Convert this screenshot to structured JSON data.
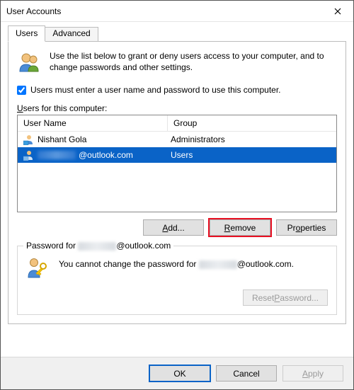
{
  "window": {
    "title": "User Accounts"
  },
  "tabs": {
    "users": "Users",
    "advanced": "Advanced"
  },
  "intro": "Use the list below to grant or deny users access to your computer, and to change passwords and other settings.",
  "checkbox_label": "Users must enter a user name and password to use this computer.",
  "list_label_prefix": "U",
  "list_label_rest": "sers for this computer:",
  "columns": {
    "name": "User Name",
    "group": "Group"
  },
  "rows": [
    {
      "name": "Nishant Gola",
      "group": "Administrators",
      "selected": false,
      "redacted": false
    },
    {
      "name": "@outlook.com",
      "group": "Users",
      "selected": true,
      "redacted": true
    }
  ],
  "buttons": {
    "add_pre": "A",
    "add_rest": "dd...",
    "remove_pre": "R",
    "remove_rest": "emove",
    "props_pre": "Pr",
    "props_u": "o",
    "props_rest": "perties"
  },
  "password_section": {
    "legend_prefix": "Password for ",
    "legend_suffix": "@outlook.com",
    "text_prefix": "You cannot change the password for ",
    "text_suffix": "@outlook.com.",
    "reset_pre": "Reset ",
    "reset_u": "P",
    "reset_rest": "assword..."
  },
  "bottom": {
    "ok": "OK",
    "cancel": "Cancel",
    "apply_pre": "A",
    "apply_rest": "pply"
  }
}
